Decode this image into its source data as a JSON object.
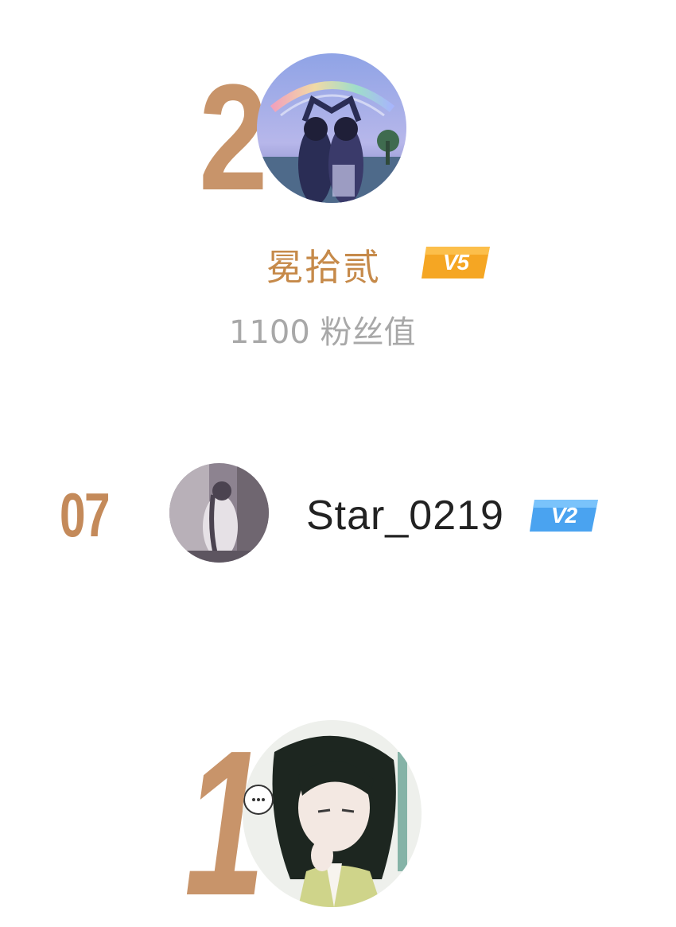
{
  "ranking": {
    "second": {
      "rank": "2",
      "name": "冕拾贰",
      "vip_level": "V5",
      "fans_value": "1100 粉丝值",
      "colors": {
        "rank": "#c8946a",
        "name": "#c68a4a",
        "badge": "#f5a623"
      }
    },
    "seventh": {
      "rank": "07",
      "name": "Star_0219",
      "vip_level": "V2",
      "colors": {
        "rank": "#c48a5a",
        "name": "#222222",
        "badge": "#4aa3f0"
      }
    },
    "first": {
      "rank": "1",
      "colors": {
        "rank": "#c8946a"
      }
    }
  }
}
